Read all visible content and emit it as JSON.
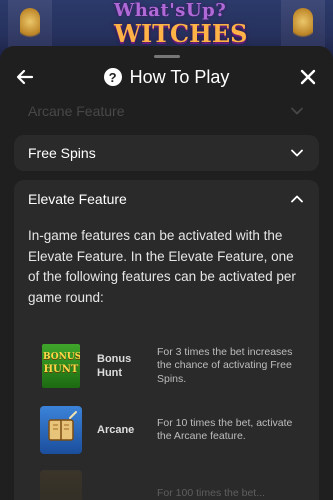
{
  "game": {
    "logo_line1": "What'sUp?",
    "logo_line2": "WITCHES"
  },
  "header": {
    "title": "How To Play",
    "help_icon_glyph": "?"
  },
  "sections": {
    "faded": {
      "label": "Arcane Feature"
    },
    "free_spins": {
      "label": "Free Spins"
    },
    "elevate": {
      "label": "Elevate Feature",
      "description": "In-game features can be activated with the Elevate Feature. In the Elevate Feature, one of the following features can be activated per game round:",
      "features": [
        {
          "thumb_line1": "BONUS",
          "thumb_line2": "HUNT",
          "name": "Bonus Hunt",
          "desc": "For 3 times the bet increases the chance of activating Free Spins.",
          "icon": "bonus-hunt-icon"
        },
        {
          "name": "Arcane",
          "desc": "For 10 times the bet, activate the Arcane feature.",
          "icon": "arcane-book-icon"
        },
        {
          "name": "",
          "desc": "For 100 times the bet...",
          "icon": "feature-thumb-icon"
        }
      ]
    }
  },
  "colors": {
    "sheet_bg": "#1f1f1f",
    "card_bg": "#2a2a2a",
    "text": "#ffffff"
  }
}
